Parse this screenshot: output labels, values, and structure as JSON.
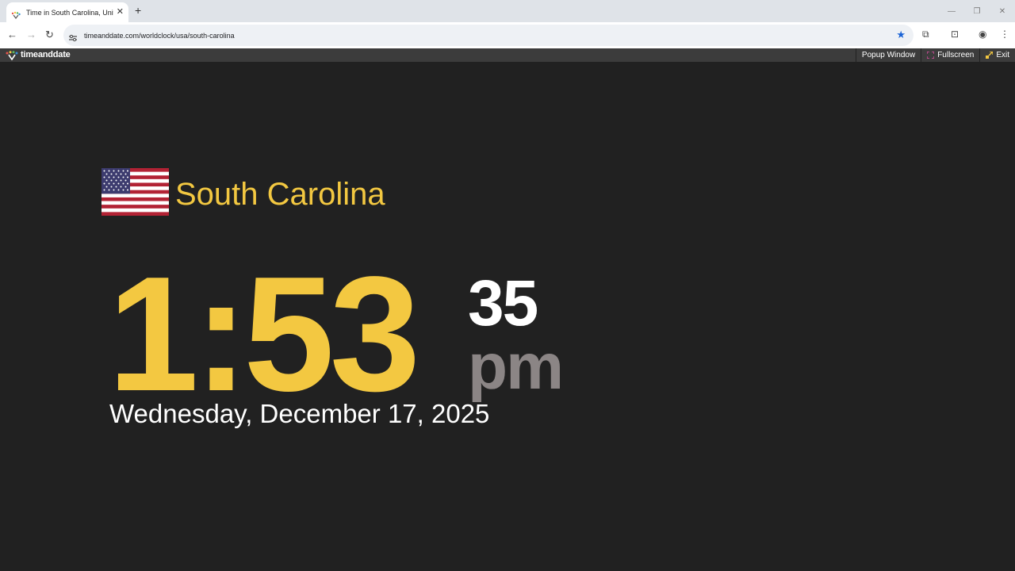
{
  "browser": {
    "tab_title": "Time in South Carolina, United",
    "url": "timeanddate.com/worldclock/usa/south-carolina",
    "new_tab": "+",
    "tab_close": "✕"
  },
  "sitebar": {
    "logo_text": "timeanddate",
    "popup_label": "Popup Window",
    "fullscreen_label": "Fullscreen",
    "exit_label": "Exit"
  },
  "clock": {
    "location": "South Carolina",
    "time": "1:53",
    "seconds": "35",
    "ampm": "pm",
    "date": "Wednesday, December 17, 2025"
  },
  "colors": {
    "accent": "#f3c841",
    "background": "#212121",
    "ampm": "#8b8585",
    "star": "#1a63d6"
  },
  "icons": {
    "flag": "us-flag-icon",
    "popup": "popup-window-icon",
    "fullscreen": "fullscreen-icon",
    "exit": "exit-icon"
  }
}
